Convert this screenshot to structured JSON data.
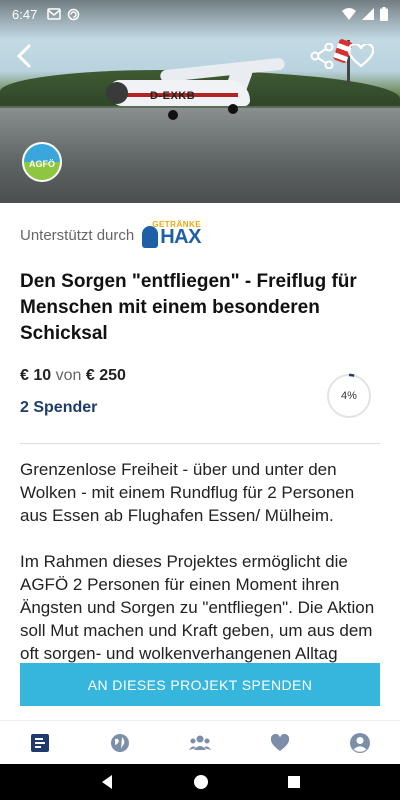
{
  "status_bar": {
    "time": "6:47"
  },
  "hero": {
    "registration": "D-EXKB",
    "org_logo_text": "AGFÖ"
  },
  "sponsor": {
    "label": "Unterstützt durch",
    "logo_top": "GETRÄNKE",
    "logo_main": "HAX"
  },
  "project": {
    "title": "Den Sorgen \"entfliegen\" - Freiflug für Menschen mit einem besonderen Schicksal",
    "amount_raised": "€ 10",
    "von": "von",
    "amount_goal": "€ 250",
    "donors": "2 Spender",
    "progress_label": "4%",
    "progress_fraction": 0.04
  },
  "description": {
    "paragraph1": "Grenzenlose Freiheit - über und unter den Wolken - mit einem Rundflug für 2 Personen aus Essen ab Flughafen Essen/ Mülheim.",
    "paragraph2": "Im Rahmen dieses Projektes ermöglicht die AGFÖ 2 Personen für einen Moment ihren Ängsten und Sorgen zu \"entfliegen\". Die Aktion soll Mut machen und Kraft geben, um aus dem oft sorgen- und wolkenverhangenen Alltag bringen"
  },
  "cta": {
    "label": "AN DIESES PROJEKT SPENDEN"
  },
  "colors": {
    "accent": "#36b6dd",
    "navy": "#1f3b6e",
    "nav_icon": "#1f3b6e"
  },
  "bottom_nav": [
    "news-icon",
    "globe-icon",
    "group-icon",
    "heart-icon",
    "profile-icon"
  ]
}
